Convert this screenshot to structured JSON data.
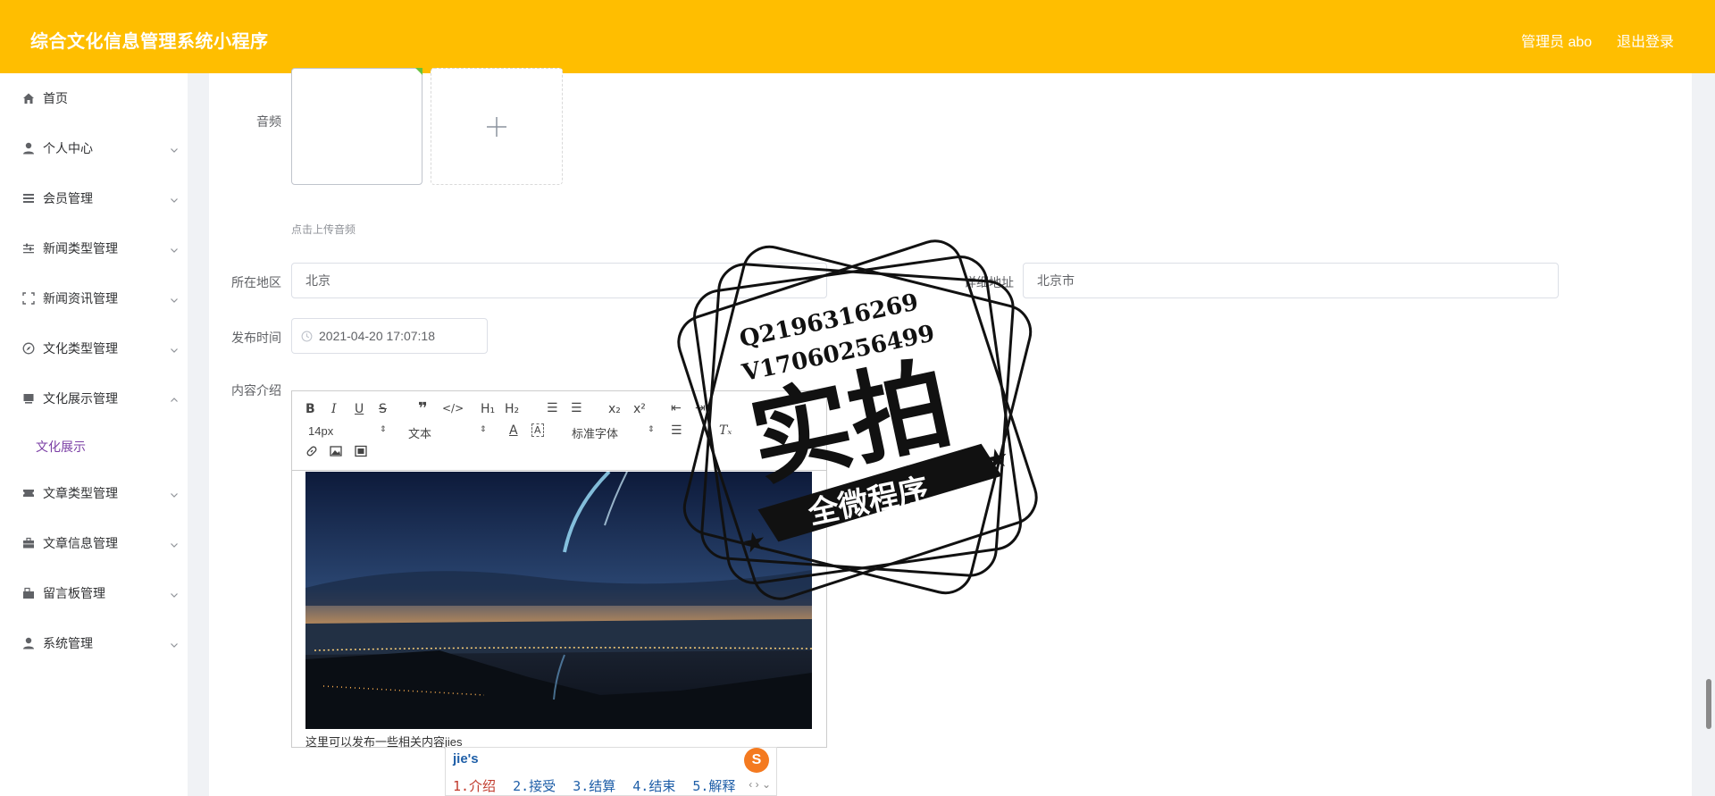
{
  "header": {
    "title": "综合文化信息管理系统小程序",
    "user": "管理员 abo",
    "logout": "退出登录"
  },
  "sidebar": {
    "items": [
      {
        "label": "首页",
        "icon": "home-icon"
      },
      {
        "label": "个人中心",
        "icon": "user-icon"
      },
      {
        "label": "会员管理",
        "icon": "list-icon"
      },
      {
        "label": "新闻类型管理",
        "icon": "sliders-icon"
      },
      {
        "label": "新闻资讯管理",
        "icon": "frame-icon"
      },
      {
        "label": "文化类型管理",
        "icon": "compass-icon"
      },
      {
        "label": "文化展示管理",
        "icon": "monitor-icon"
      },
      {
        "label": "文章类型管理",
        "icon": "ticket-icon"
      },
      {
        "label": "文章信息管理",
        "icon": "briefcase-icon"
      },
      {
        "label": "留言板管理",
        "icon": "bag-icon"
      },
      {
        "label": "系统管理",
        "icon": "user-icon"
      }
    ],
    "active_sub": "文化展示"
  },
  "form": {
    "audio_label": "音频",
    "audio_hint": "点击上传音频",
    "region_label": "所在地区",
    "region_value": "北京",
    "address_label": "详细地址",
    "address_value": "北京市",
    "time_label": "发布时间",
    "time_value": "2021-04-20 17:07:18",
    "content_label": "内容介绍"
  },
  "editor": {
    "size": "14px",
    "paragraph": "文本",
    "font": "标准字体",
    "content_text": "这里可以发布一些相关内容jies"
  },
  "ime": {
    "input": "jie's",
    "candidates": [
      "1.介绍",
      "2.接受",
      "3.结算",
      "4.结束",
      "5.解释"
    ]
  },
  "stamp": {
    "line1": "Q2196316269",
    "line2": "V17060256499",
    "big": "实拍",
    "ribbon": "全微程序"
  },
  "colors": {
    "header": "#ffbe00",
    "active_sub": "#7b3fa5"
  }
}
